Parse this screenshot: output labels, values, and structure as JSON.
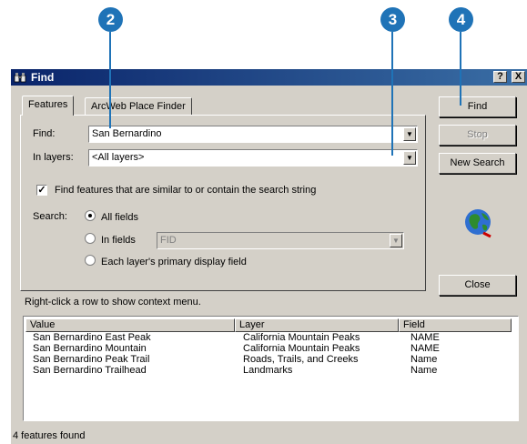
{
  "callouts": [
    "2",
    "3",
    "4"
  ],
  "window": {
    "title": "Find",
    "help_label": "?",
    "close_label": "X"
  },
  "tabs": [
    "Features",
    "ArcWeb Place Finder"
  ],
  "find": {
    "label": "Find:",
    "value": "San Bernardino"
  },
  "layers": {
    "label": "In layers:",
    "value": "<All layers>"
  },
  "similar_checkbox": {
    "label": "Find features that are similar to or contain the search string",
    "checked": true
  },
  "search": {
    "label": "Search:",
    "options": [
      "All fields",
      "In fields",
      "Each layer's primary display field"
    ],
    "selected": "All fields",
    "in_fields_value": "FID"
  },
  "buttons": {
    "find": "Find",
    "stop": "Stop",
    "new_search": "New Search",
    "close": "Close"
  },
  "hint": "Right-click a row to show context menu.",
  "results": {
    "columns": [
      "Value",
      "Layer",
      "Field"
    ],
    "rows": [
      [
        "San Bernardino East Peak",
        "California Mountain Peaks",
        "NAME"
      ],
      [
        "San Bernardino Mountain",
        "California Mountain Peaks",
        "NAME"
      ],
      [
        "San Bernardino Peak Trail",
        "Roads, Trails, and Creeks",
        "Name"
      ],
      [
        "San Bernardino Trailhead",
        "Landmarks",
        "Name"
      ]
    ]
  },
  "status": "4 features found",
  "icons": [
    "binoculars-icon",
    "globe-icon",
    "chevron-down-icon"
  ],
  "colors": {
    "callout": "#1f73b7",
    "titlebar": "#0a246a",
    "dialog": "#d4d0c8"
  }
}
